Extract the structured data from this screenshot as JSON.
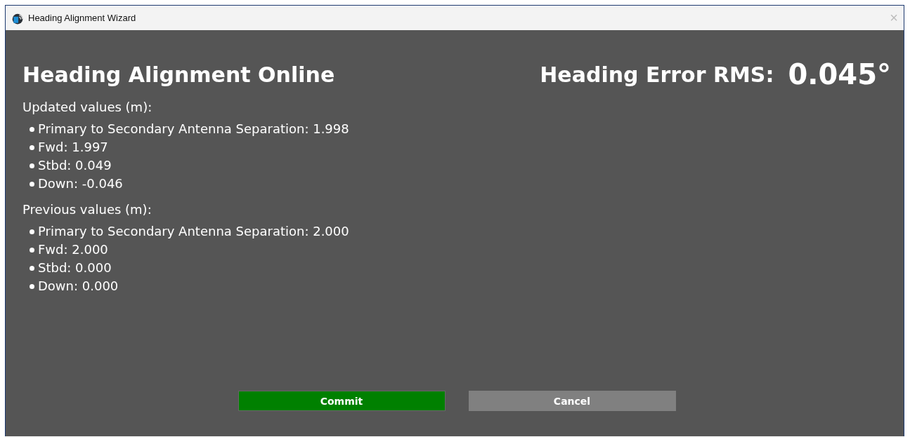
{
  "window": {
    "title": "Heading Alignment Wizard",
    "close": "×"
  },
  "heading": "Heading Alignment Online",
  "error_label": "Heading Error RMS:",
  "error_value": "0.045°",
  "sections": [
    {
      "title": "Updated values (m):",
      "items": [
        "Primary to Secondary Antenna Separation: 1.998",
        "Fwd: 1.997",
        "Stbd: 0.049",
        "Down: -0.046"
      ]
    },
    {
      "title": "Previous values (m):",
      "items": [
        "Primary to Secondary Antenna Separation: 2.000",
        "Fwd: 2.000",
        "Stbd: 0.000",
        "Down: 0.000"
      ]
    }
  ],
  "buttons": [
    {
      "label": "Commit",
      "kind": "primary"
    },
    {
      "label": "Cancel",
      "kind": "secondary"
    }
  ]
}
